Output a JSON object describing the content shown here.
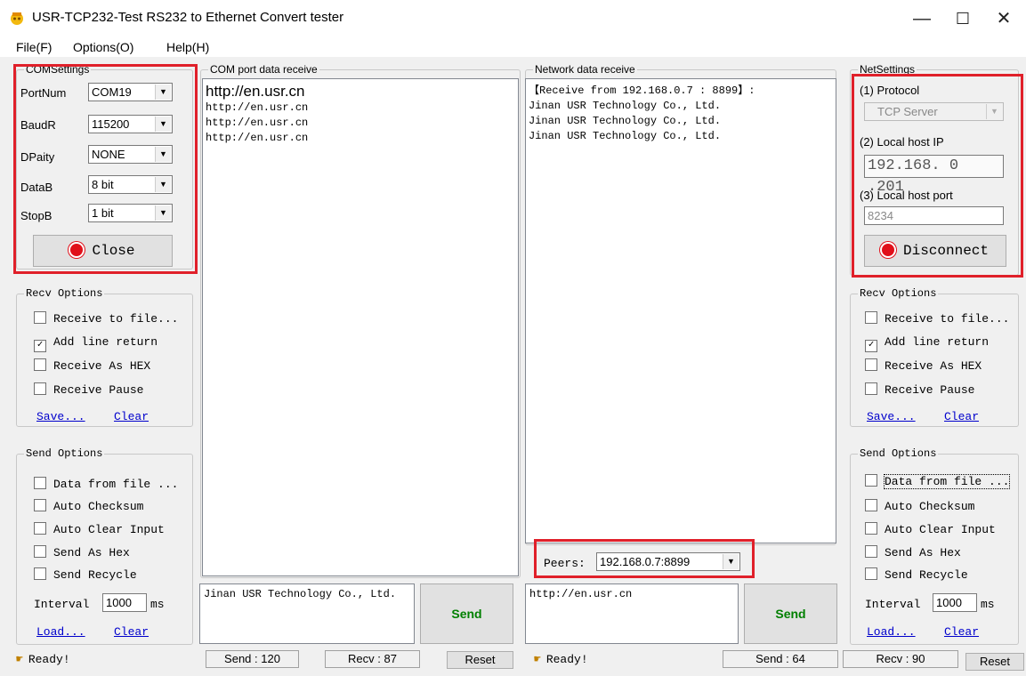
{
  "window": {
    "title": "USR-TCP232-Test  RS232 to Ethernet Convert tester",
    "minimize_glyph": "—",
    "maximize_glyph": "☐",
    "close_glyph": "✕"
  },
  "menu": [
    "File(F)",
    "Options(O)",
    "Help(H)"
  ],
  "com_settings": {
    "legend": "COMSettings",
    "port_label": "PortNum",
    "port_value": "COM19",
    "baud_label": "BaudR",
    "baud_value": "115200",
    "parity_label": "DPaity",
    "parity_value": "NONE",
    "databits_label": "DataB",
    "databits_value": "8 bit",
    "stopbits_label": "StopB",
    "stopbits_value": "1 bit",
    "button_label": "Close"
  },
  "com_receive": {
    "legend": "COM port data receive",
    "heading": "http://en.usr.cn",
    "lines": [
      "http://en.usr.cn",
      "http://en.usr.cn",
      "http://en.usr.cn"
    ]
  },
  "net_receive": {
    "legend": "Network data receive",
    "lines": [
      "【Receive from 192.168.0.7 : 8899】:",
      "Jinan USR Technology Co., Ltd.",
      "Jinan USR Technology Co., Ltd.",
      "Jinan USR Technology Co., Ltd."
    ]
  },
  "net_settings": {
    "legend": "NetSettings",
    "protocol_label": "(1) Protocol",
    "protocol_value": "TCP Server",
    "ip_label": "(2) Local host IP",
    "ip_value": "192.168. 0 .201",
    "port_label": "(3) Local host port",
    "port_value": "8234",
    "button_label": "Disconnect"
  },
  "left_recv": {
    "legend": "Recv Options",
    "options": [
      {
        "label": "Receive to file...",
        "checked": false
      },
      {
        "label": "Add line return",
        "checked": true
      },
      {
        "label": "Receive As HEX",
        "checked": false
      },
      {
        "label": "Receive Pause",
        "checked": false
      }
    ],
    "save": "Save...",
    "clear": "Clear"
  },
  "left_send": {
    "legend": "Send Options",
    "options": [
      {
        "label": "Data from file ...",
        "checked": false
      },
      {
        "label": "Auto Checksum",
        "checked": false
      },
      {
        "label": "Auto Clear Input",
        "checked": false
      },
      {
        "label": "Send As Hex",
        "checked": false
      },
      {
        "label": "Send Recycle",
        "checked": false
      }
    ],
    "interval_label": "Interval",
    "interval_value": "1000",
    "interval_unit": "ms",
    "load": "Load...",
    "clear": "Clear"
  },
  "right_recv": {
    "legend": "Recv Options",
    "options": [
      {
        "label": "Receive to file...",
        "checked": false
      },
      {
        "label": "Add line return",
        "checked": true
      },
      {
        "label": "Receive As HEX",
        "checked": false
      },
      {
        "label": "Receive Pause",
        "checked": false
      }
    ],
    "save": "Save...",
    "clear": "Clear"
  },
  "right_send": {
    "legend": "Send Options",
    "options": [
      {
        "label": "Data from file ...",
        "checked": false
      },
      {
        "label": "Auto Checksum",
        "checked": false
      },
      {
        "label": "Auto Clear Input",
        "checked": false
      },
      {
        "label": "Send As Hex",
        "checked": false
      },
      {
        "label": "Send Recycle",
        "checked": false
      }
    ],
    "interval_label": "Interval",
    "interval_value": "1000",
    "interval_unit": "ms",
    "load": "Load...",
    "clear": "Clear"
  },
  "peers": {
    "label": "Peers:",
    "value": "192.168.0.7:8899"
  },
  "com_send": {
    "text": "Jinan USR Technology Co., Ltd.",
    "button": "Send"
  },
  "net_send": {
    "text": "http://en.usr.cn",
    "button": "Send"
  },
  "status": {
    "left_ready": "Ready!",
    "left_send": "Send : 120",
    "left_recv": "Recv : 87",
    "left_reset": "Reset",
    "right_ready": "Ready!",
    "right_send": "Send : 64",
    "right_recv": "Recv : 90",
    "right_reset": "Reset"
  },
  "colors": {
    "highlight_box": "#e0202a",
    "link": "#0000cc",
    "led": "#e0101a"
  },
  "icons": {
    "app": "usr-app-icon",
    "led": "red-led-icon",
    "ready": "hand-pointer-icon"
  }
}
